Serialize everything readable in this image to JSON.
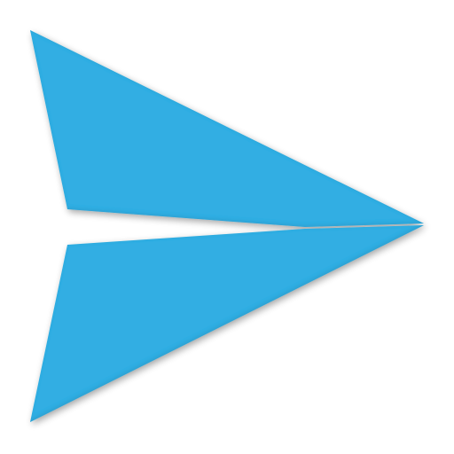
{
  "icon": {
    "name": "send-arrow-icon",
    "fill_color": "#33AEE3",
    "highlight_color": "#6FCBF0",
    "edge_shadow_color": "#1E7FA8",
    "background_color": "#FFFFFF"
  }
}
